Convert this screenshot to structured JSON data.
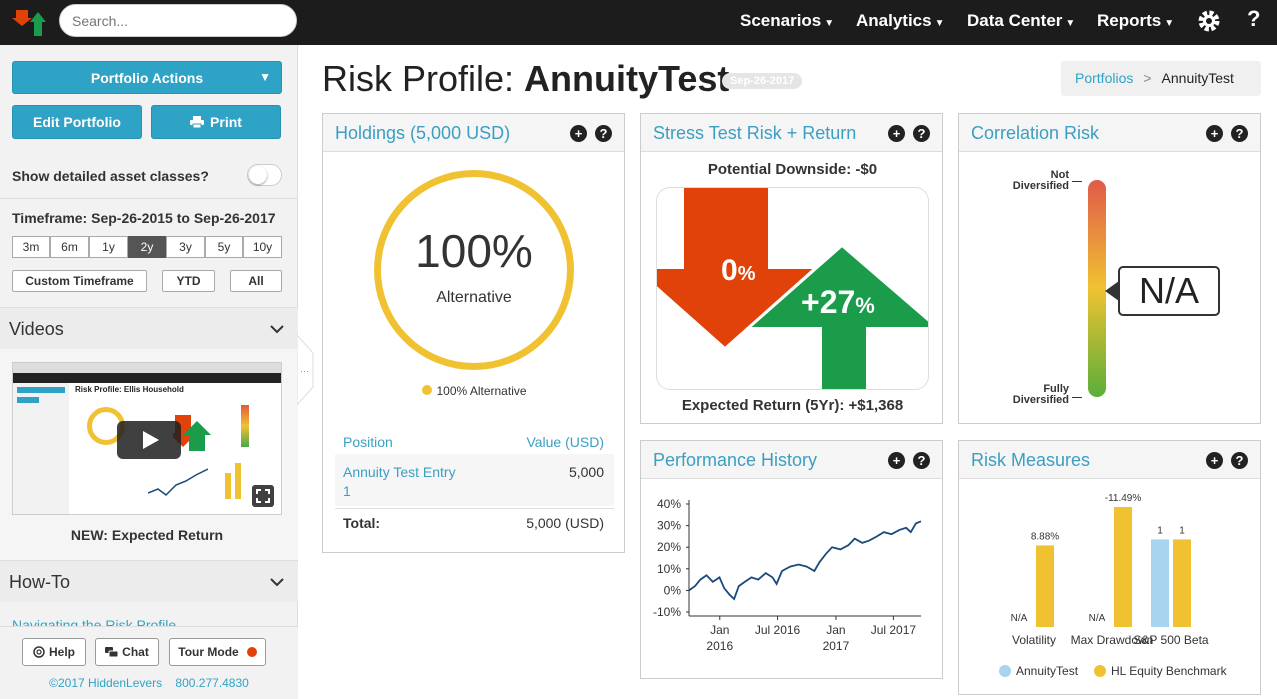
{
  "topbar": {
    "search_placeholder": "Search...",
    "nav": [
      "Scenarios",
      "Analytics",
      "Data Center",
      "Reports"
    ],
    "help": "?"
  },
  "sidebar": {
    "portfolio_actions": "Portfolio Actions",
    "edit_portfolio": "Edit Portfolio",
    "print": "Print",
    "detailed_label": "Show detailed asset classes?",
    "timeframe": "Timeframe: Sep-26-2015 to Sep-26-2017",
    "tf_buttons": [
      "3m",
      "6m",
      "1y",
      "2y",
      "3y",
      "5y",
      "10y"
    ],
    "tf_active": "2y",
    "custom_timeframe": "Custom Timeframe",
    "ytd": "YTD",
    "all": "All",
    "videos_title": "Videos",
    "video_caption": "NEW: Expected Return",
    "video_thumb_title": "Risk Profile: Ellis Household",
    "howto_title": "How-To",
    "howto_link": "Navigating the Risk Profile",
    "footer": {
      "help": "Help",
      "chat": "Chat",
      "tour": "Tour Mode",
      "copyright": "©2017 HiddenLevers",
      "phone": "800.277.4830"
    }
  },
  "header": {
    "title_prefix": "Risk Profile: ",
    "title_name": "AnnuityTest",
    "date_badge": "Sep-26-2017",
    "breadcrumb": [
      "Portfolios",
      "AnnuityTest"
    ]
  },
  "holdings": {
    "title": "Holdings (5,000 USD)",
    "donut_pct": "100%",
    "donut_label": "Alternative",
    "legend": "100% Alternative",
    "col_position": "Position",
    "col_value": "Value (USD)",
    "row_name_1": "Annuity Test Entry",
    "row_name_2": "1",
    "row_value": "5,000",
    "total_label": "Total:",
    "total_value": "5,000 (USD)",
    "colors": {
      "ring": "#f0c232"
    }
  },
  "stress": {
    "title": "Stress Test Risk + Return",
    "downside": "Potential Downside: -$0",
    "down_value": "0",
    "up_value": "+27",
    "pct": "%",
    "expected": "Expected Return (5Yr): +$1,368",
    "colors": {
      "down": "#e0420a",
      "up": "#1a9c4a"
    }
  },
  "correlation": {
    "title": "Correlation Risk",
    "top_label_1": "Not",
    "top_label_2": "Diversified",
    "bottom_label_1": "Fully",
    "bottom_label_2": "Diversified",
    "value": "N/A"
  },
  "performance": {
    "title": "Performance History"
  },
  "risk_measures": {
    "title": "Risk Measures"
  },
  "chart_data": [
    {
      "type": "line",
      "title": "Performance History",
      "y_ticks": [
        "40%",
        "30%",
        "20%",
        "10%",
        "0%",
        "-10%"
      ],
      "ylim": [
        -10,
        40
      ],
      "x_ticks": [
        {
          "line1": "Jan",
          "line2": "2016"
        },
        {
          "line1": "Jul 2016",
          "line2": ""
        },
        {
          "line1": "Jan",
          "line2": "2017"
        },
        {
          "line1": "Jul 2017",
          "line2": ""
        }
      ],
      "x_tick_dates": [
        "2016-01-01",
        "2016-07-01",
        "2017-01-01",
        "2017-07-01"
      ],
      "xlim": [
        "2015-09-26",
        "2017-09-26"
      ],
      "series": [
        {
          "color": "#1a4a7a",
          "points": [
            [
              "2015-09-26",
              0
            ],
            [
              "2015-10-15",
              2
            ],
            [
              "2015-11-01",
              5
            ],
            [
              "2015-11-20",
              7
            ],
            [
              "2015-12-10",
              4
            ],
            [
              "2015-12-31",
              6
            ],
            [
              "2016-01-15",
              1
            ],
            [
              "2016-02-01",
              -2
            ],
            [
              "2016-02-15",
              -4
            ],
            [
              "2016-03-01",
              2
            ],
            [
              "2016-03-20",
              4
            ],
            [
              "2016-04-10",
              6
            ],
            [
              "2016-05-01",
              5
            ],
            [
              "2016-05-25",
              8
            ],
            [
              "2016-06-15",
              6
            ],
            [
              "2016-06-28",
              3
            ],
            [
              "2016-07-15",
              9
            ],
            [
              "2016-08-10",
              11
            ],
            [
              "2016-09-05",
              12
            ],
            [
              "2016-10-01",
              11
            ],
            [
              "2016-10-25",
              9
            ],
            [
              "2016-11-10",
              13
            ],
            [
              "2016-12-01",
              17
            ],
            [
              "2016-12-20",
              20
            ],
            [
              "2017-01-15",
              19
            ],
            [
              "2017-02-10",
              21
            ],
            [
              "2017-03-01",
              24
            ],
            [
              "2017-03-25",
              22
            ],
            [
              "2017-04-15",
              23
            ],
            [
              "2017-05-10",
              25
            ],
            [
              "2017-06-01",
              27
            ],
            [
              "2017-06-25",
              26
            ],
            [
              "2017-07-20",
              28
            ],
            [
              "2017-08-10",
              29
            ],
            [
              "2017-08-25",
              27
            ],
            [
              "2017-09-10",
              31
            ],
            [
              "2017-09-26",
              32
            ]
          ]
        }
      ],
      "grid": false
    },
    {
      "type": "bar",
      "title": "Risk Measures",
      "categories": [
        "Volatility",
        "Max Drawdown",
        "S&P 500 Beta"
      ],
      "category_labels_shown": [
        "Volatility",
        "Max Drawdown",
        "S&P 500 Beta"
      ],
      "series": [
        {
          "name": "AnnuityTest",
          "color": "#a8d4f0",
          "values": [
            null,
            null,
            1
          ],
          "labels": [
            "N/A",
            "N/A",
            "1"
          ]
        },
        {
          "name": "HL Equity Benchmark",
          "color": "#f0c232",
          "values": [
            8.88,
            11.49,
            1
          ],
          "labels": [
            "8.88%",
            "-11.49%",
            "1"
          ]
        }
      ],
      "relative_heights": [
        0.68,
        1.0,
        0.73
      ],
      "legend": "bottom"
    }
  ]
}
